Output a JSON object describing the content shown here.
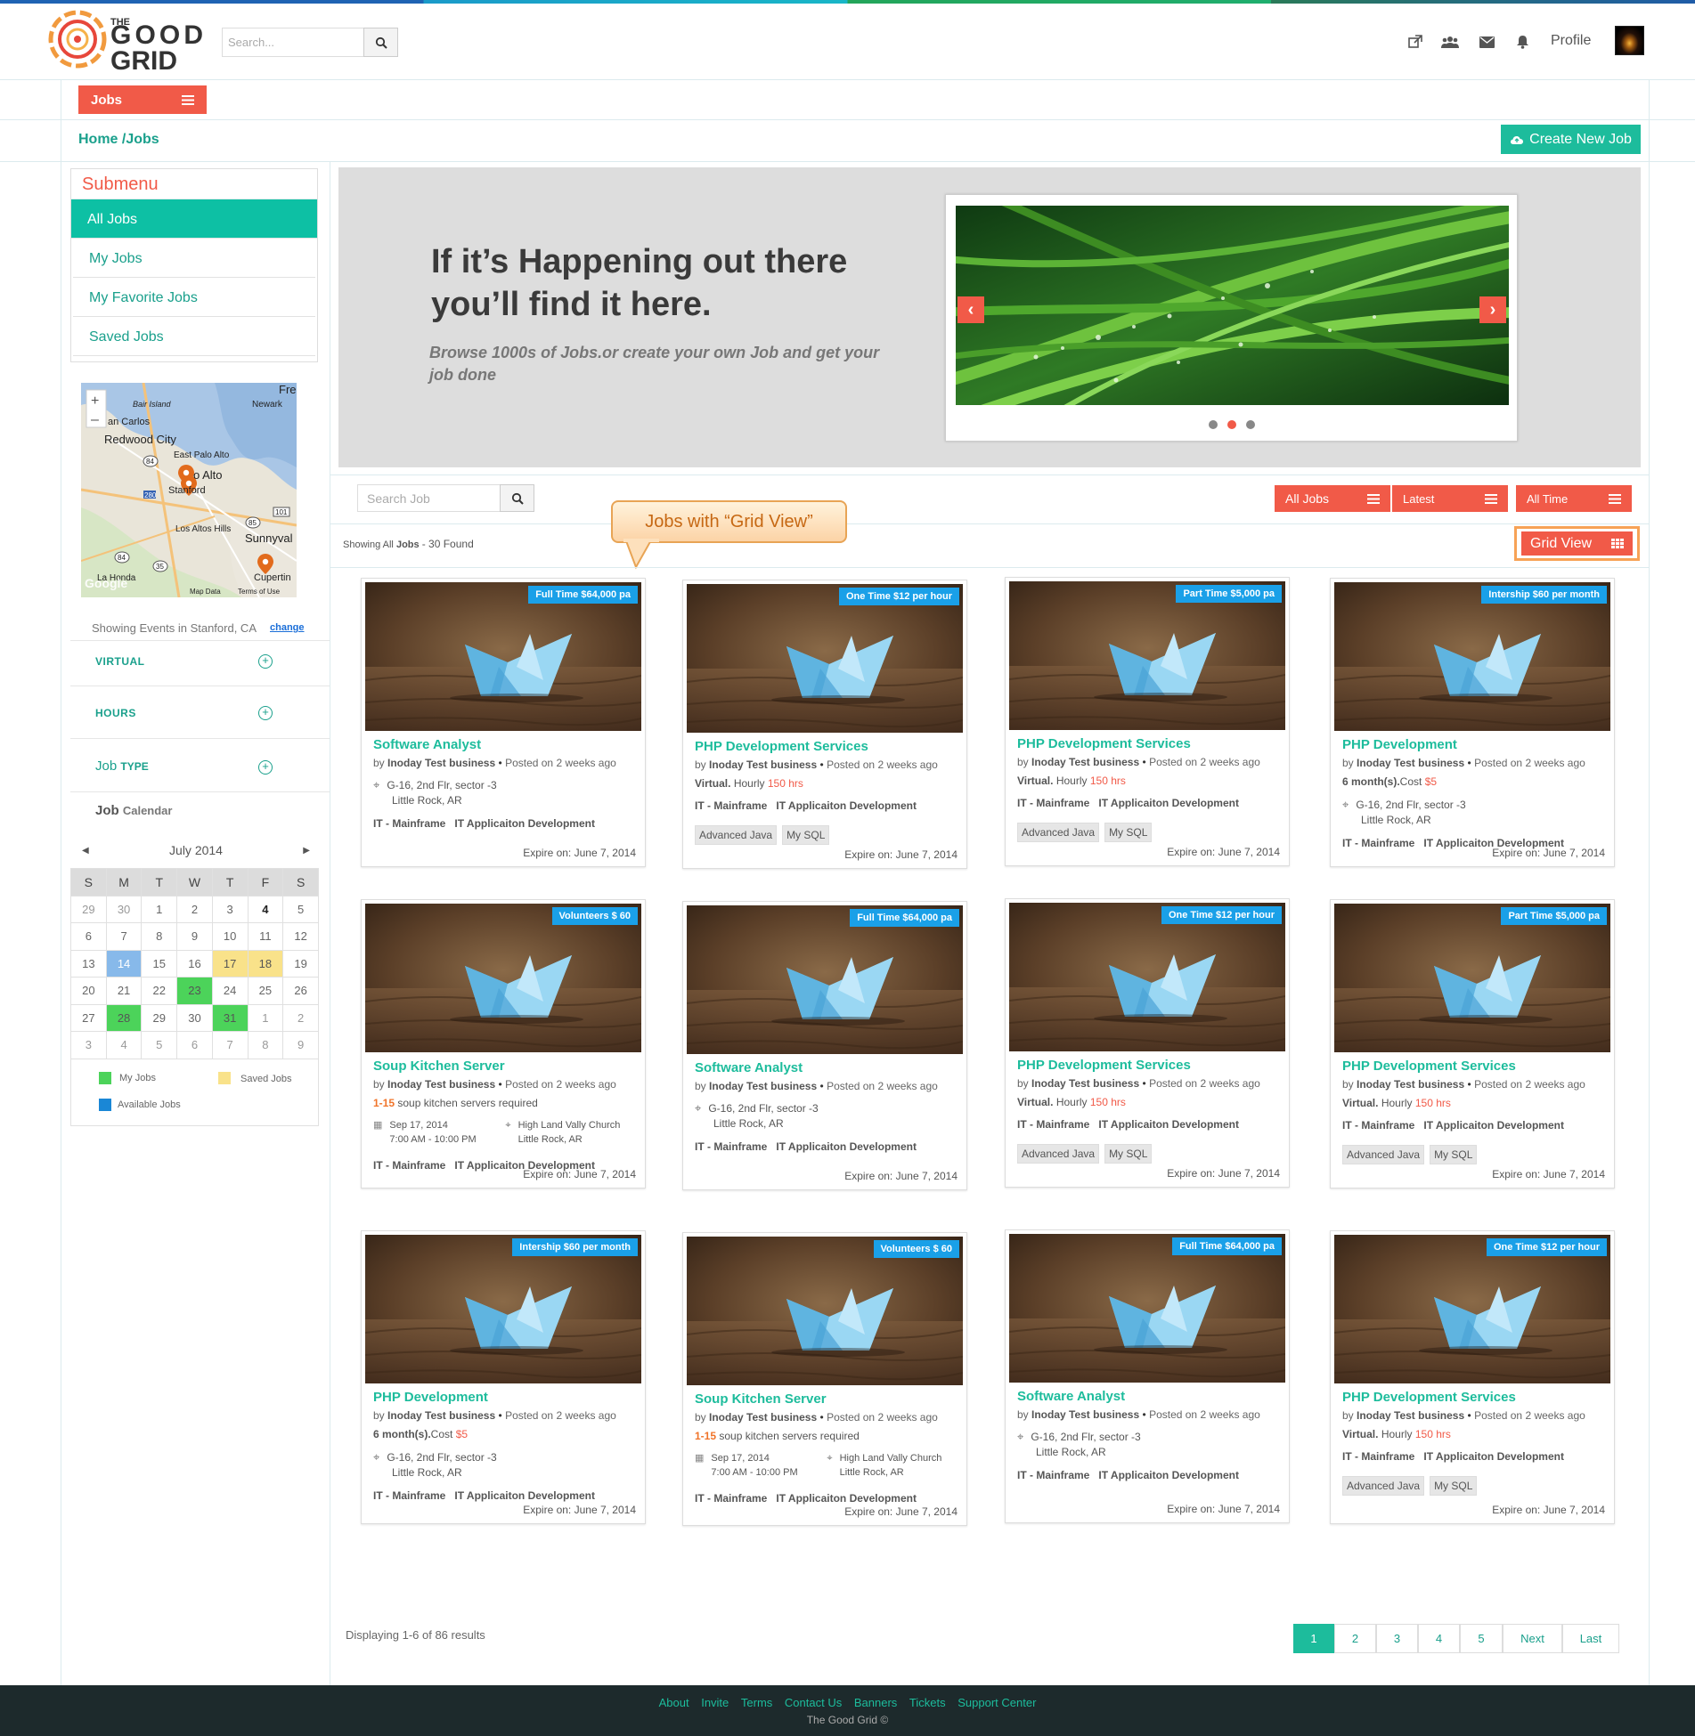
{
  "header": {
    "search_placeholder": "Search...",
    "profile_label": "Profile"
  },
  "nav": {
    "jobs_tab": "Jobs",
    "breadcrumb": "Home /Jobs",
    "create_button": "Create New Job"
  },
  "submenu": {
    "title": "Submenu",
    "items": [
      "All Jobs",
      "My Jobs",
      "My Favorite Jobs",
      "Saved Jobs"
    ]
  },
  "map": {
    "labels": [
      "Fre",
      "Bair Island",
      "Newark",
      "an Carlos",
      "Redwood City",
      "East Palo Alto",
      "o Alto",
      "Stanford",
      "Los Altos Hills",
      "Sunnyval",
      "La Honda",
      "Cupertin",
      "Map Data",
      "Terms of Use",
      "Google"
    ],
    "zoom_in": "+",
    "zoom_out": "–",
    "road_shields": [
      "84",
      "280",
      "101",
      "85",
      "84",
      "35"
    ]
  },
  "events": {
    "text": "Showing Events in Stanford, CA",
    "change": "change"
  },
  "filters": {
    "virtual": "VIRTUAL",
    "hours": "HOURS",
    "job_type_a": "Job",
    "job_type_b": "TYPE",
    "calendar_a": "Job",
    "calendar_b": "Calendar"
  },
  "calendar": {
    "month": "July 2014",
    "days": [
      "S",
      "M",
      "T",
      "W",
      "T",
      "F",
      "S"
    ],
    "weeks": [
      [
        "29",
        "30",
        "1",
        "2",
        "3",
        "4",
        "5"
      ],
      [
        "6",
        "7",
        "8",
        "9",
        "10",
        "11",
        "12"
      ],
      [
        "13",
        "14",
        "15",
        "16",
        "17",
        "18",
        "19"
      ],
      [
        "20",
        "21",
        "22",
        "23",
        "24",
        "25",
        "26"
      ],
      [
        "27",
        "28",
        "29",
        "30",
        "31",
        "1",
        "2"
      ],
      [
        "3",
        "4",
        "5",
        "6",
        "7",
        "8",
        "9"
      ]
    ],
    "legend": {
      "my_jobs": "My Jobs",
      "saved_jobs": "Saved Jobs",
      "available_jobs": "Available Jobs"
    },
    "colors": {
      "my_jobs": "#4cd35a",
      "saved_jobs": "#f9e28a",
      "available_jobs": "#1a87d6"
    }
  },
  "banner": {
    "heading_1": "If it’s Happening out there",
    "heading_2": "you’ll find it here.",
    "subtitle": "Browse 1000s of Jobs.or create your own Job and get your job done"
  },
  "toolbar": {
    "search_placeholder": "Search Job",
    "all_jobs": "All Jobs",
    "latest": "Latest",
    "all_time": "All Time",
    "grid_view": "Grid View",
    "callout": "Jobs with “Grid View”"
  },
  "showing": {
    "prefix": "Showing",
    "all": "All",
    "jobs": "Jobs",
    "count": "- 30 Found"
  },
  "jobs": [
    {
      "badge": "Full Time $64,000 pa",
      "title": "Software Analyst",
      "by": "Inoday Test business",
      "posted": "Posted on 2 weeks ago",
      "address_1": "G-16, 2nd Flr, sector -3",
      "address_2": "Little Rock, AR",
      "cat_1": "IT - Mainframe",
      "cat_2": "IT Applicaiton Development",
      "expire": "Expire on: June 7, 2014"
    },
    {
      "badge": "One Time $12 per hour",
      "title": "PHP Development Services",
      "by": "Inoday Test business",
      "posted": "Posted on 2 weeks ago",
      "virtual": "Virtual.",
      "hourly": "Hourly",
      "hours": "150 hrs",
      "cat_1": "IT - Mainframe",
      "cat_2": "IT Applicaiton Development",
      "tag_1": "Advanced Java",
      "tag_2": "My SQL",
      "expire": "Expire on: June 7, 2014"
    },
    {
      "badge": "Part Time $5,000 pa",
      "title": "PHP Development Services",
      "by": "Inoday Test business",
      "posted": "Posted on 2 weeks ago",
      "virtual": "Virtual.",
      "hourly": "Hourly",
      "hours": "150 hrs",
      "cat_1": "IT - Mainframe",
      "cat_2": "IT Applicaiton Development",
      "tag_1": "Advanced Java",
      "tag_2": "My SQL",
      "expire": "Expire on: June 7, 2014"
    },
    {
      "badge": "Intership $60 per month",
      "title": "PHP Development",
      "by": "Inoday Test business",
      "posted": "Posted on 2 weeks ago",
      "duration": "6 month(s).",
      "cost_label": "Cost",
      "cost": "$5",
      "address_1": "G-16, 2nd Flr, sector -3",
      "address_2": "Little Rock, AR",
      "cat_1": "IT - Mainframe",
      "cat_2": "IT Applicaiton Development",
      "expire": "Expire on: June 7, 2014"
    },
    {
      "badge": "Volunteers  $ 60",
      "title": "Soup Kitchen Server",
      "by": "Inoday Test business",
      "posted": "Posted on 2 weeks ago",
      "range": "1-15",
      "range_text": "soup kitchen servers required",
      "date": "Sep 17, 2014",
      "time": "7:00 AM - 10:00 PM",
      "venue_1": "High Land Vally Church",
      "venue_2": "Little Rock, AR",
      "cat_1": "IT - Mainframe",
      "cat_2": "IT Applicaiton Development",
      "expire": "Expire on: June 7, 2014"
    },
    {
      "badge": "Full Time $64,000 pa",
      "title": "Software Analyst",
      "by": "Inoday Test business",
      "posted": "Posted on 2 weeks ago",
      "address_1": "G-16, 2nd Flr, sector -3",
      "address_2": "Little Rock, AR",
      "cat_1": "IT - Mainframe",
      "cat_2": "IT Applicaiton Development",
      "expire": "Expire on: June 7, 2014"
    },
    {
      "badge": "One Time $12 per hour",
      "title": "PHP Development Services",
      "by": "Inoday Test business",
      "posted": "Posted on 2 weeks ago",
      "virtual": "Virtual.",
      "hourly": "Hourly",
      "hours": "150 hrs",
      "cat_1": "IT - Mainframe",
      "cat_2": "IT Applicaiton Development",
      "tag_1": "Advanced Java",
      "tag_2": "My SQL",
      "expire": "Expire on: June 7, 2014"
    },
    {
      "badge": "Part Time $5,000 pa",
      "title": "PHP Development Services",
      "by": "Inoday Test business",
      "posted": "Posted on 2 weeks ago",
      "virtual": "Virtual.",
      "hourly": "Hourly",
      "hours": "150 hrs",
      "cat_1": "IT - Mainframe",
      "cat_2": "IT Applicaiton Development",
      "tag_1": "Advanced Java",
      "tag_2": "My SQL",
      "expire": "Expire on: June 7, 2014"
    },
    {
      "badge": "Intership $60 per month",
      "title": "PHP Development",
      "by": "Inoday Test business",
      "posted": "Posted on 2 weeks ago",
      "duration": "6 month(s).",
      "cost_label": "Cost",
      "cost": "$5",
      "address_1": "G-16, 2nd Flr, sector -3",
      "address_2": "Little Rock, AR",
      "cat_1": "IT - Mainframe",
      "cat_2": "IT Applicaiton Development",
      "expire": "Expire on: June 7, 2014"
    },
    {
      "badge": "Volunteers  $ 60",
      "title": "Soup Kitchen Server",
      "by": "Inoday Test business",
      "posted": "Posted on 2 weeks ago",
      "range": "1-15",
      "range_text": "soup kitchen servers required",
      "date": "Sep 17, 2014",
      "time": "7:00 AM - 10:00 PM",
      "venue_1": "High Land Vally Church",
      "venue_2": "Little Rock, AR",
      "cat_1": "IT - Mainframe",
      "cat_2": "IT Applicaiton Development",
      "expire": "Expire on: June 7, 2014"
    },
    {
      "badge": "Full Time $64,000 pa",
      "title": "Software Analyst",
      "by": "Inoday Test business",
      "posted": "Posted on 2 weeks ago",
      "address_1": "G-16, 2nd Flr, sector -3",
      "address_2": "Little Rock, AR",
      "cat_1": "IT - Mainframe",
      "cat_2": "IT Applicaiton Development",
      "expire": "Expire on: June 7, 2014"
    },
    {
      "badge": "One Time $12 per hour",
      "title": "PHP Development Services",
      "by": "Inoday Test business",
      "posted": "Posted on 2 weeks ago",
      "virtual": "Virtual.",
      "hourly": "Hourly",
      "hours": "150 hrs",
      "cat_1": "IT - Mainframe",
      "cat_2": "IT Applicaiton Development",
      "tag_1": "Advanced Java",
      "tag_2": "My SQL",
      "expire": "Expire on: June 7, 2014"
    }
  ],
  "pagination": {
    "summary": "Displaying 1-6 of 86 results",
    "pages": [
      "1",
      "2",
      "3",
      "4",
      "5"
    ],
    "next": "Next",
    "last": "Last"
  },
  "footer": {
    "links": [
      "About",
      "Invite",
      "Terms",
      "Contact Us",
      "Banners",
      "Tickets",
      "Support Center"
    ],
    "copyright": "The Good Grid ©"
  },
  "logo": {
    "line_1": "THE",
    "line_2": "GOOD",
    "line_3": "GRID"
  },
  "colors": {
    "accent_teal": "#1dbc9c",
    "accent_red": "#f15a48",
    "badge_blue": "#1aa0e8"
  }
}
